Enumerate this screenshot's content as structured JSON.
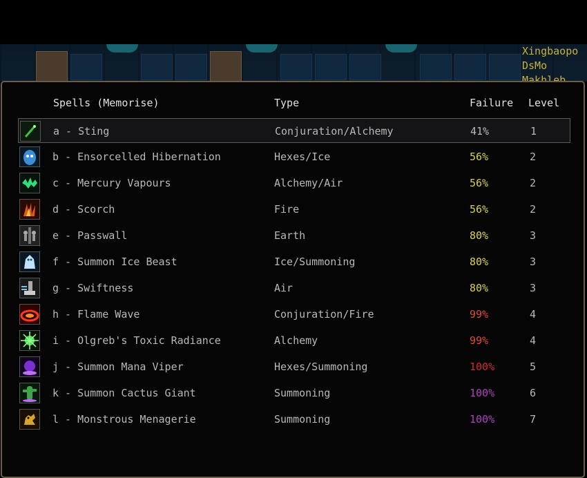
{
  "players": [
    "Xingbaopo",
    "DsMo",
    "Makhleb"
  ],
  "headers": {
    "title": "Spells (Memorise)",
    "type": "Type",
    "failure": "Failure",
    "level": "Level"
  },
  "spells": [
    {
      "name": "a - Sting",
      "type": "Conjuration/Alchemy",
      "failure": "41%",
      "level": "1",
      "color": "#b9b9b9",
      "icon": "sting-icon"
    },
    {
      "name": "b - Ensorcelled Hibernation",
      "type": "Hexes/Ice",
      "failure": "56%",
      "level": "2",
      "color": "#d9d44b",
      "icon": "hibernation-icon"
    },
    {
      "name": "c - Mercury Vapours",
      "type": "Alchemy/Air",
      "failure": "56%",
      "level": "2",
      "color": "#d9d44b",
      "icon": "mercury-vapours-icon"
    },
    {
      "name": "d - Scorch",
      "type": "Fire",
      "failure": "56%",
      "level": "2",
      "color": "#d9d44b",
      "icon": "scorch-icon"
    },
    {
      "name": "e - Passwall",
      "type": "Earth",
      "failure": "80%",
      "level": "3",
      "color": "#d9d44b",
      "icon": "passwall-icon"
    },
    {
      "name": "f - Summon Ice Beast",
      "type": "Ice/Summoning",
      "failure": "80%",
      "level": "3",
      "color": "#d9d44b",
      "icon": "ice-beast-icon"
    },
    {
      "name": "g - Swiftness",
      "type": "Air",
      "failure": "80%",
      "level": "3",
      "color": "#d9d44b",
      "icon": "swiftness-icon"
    },
    {
      "name": "h - Flame Wave",
      "type": "Conjuration/Fire",
      "failure": "99%",
      "level": "4",
      "color": "#e04a3a",
      "icon": "flame-wave-icon"
    },
    {
      "name": "i - Olgreb's Toxic Radiance",
      "type": "Alchemy",
      "failure": "99%",
      "level": "4",
      "color": "#e04a3a",
      "icon": "toxic-radiance-icon"
    },
    {
      "name": "j - Summon Mana Viper",
      "type": "Hexes/Summoning",
      "failure": "100%",
      "level": "5",
      "color": "#d42a2a",
      "icon": "mana-viper-icon"
    },
    {
      "name": "k - Summon Cactus Giant",
      "type": "Summoning",
      "failure": "100%",
      "level": "6",
      "color": "#b040c0",
      "icon": "cactus-giant-icon"
    },
    {
      "name": "l - Monstrous Menagerie",
      "type": "Summoning",
      "failure": "100%",
      "level": "7",
      "color": "#b040c0",
      "icon": "menagerie-icon"
    }
  ]
}
